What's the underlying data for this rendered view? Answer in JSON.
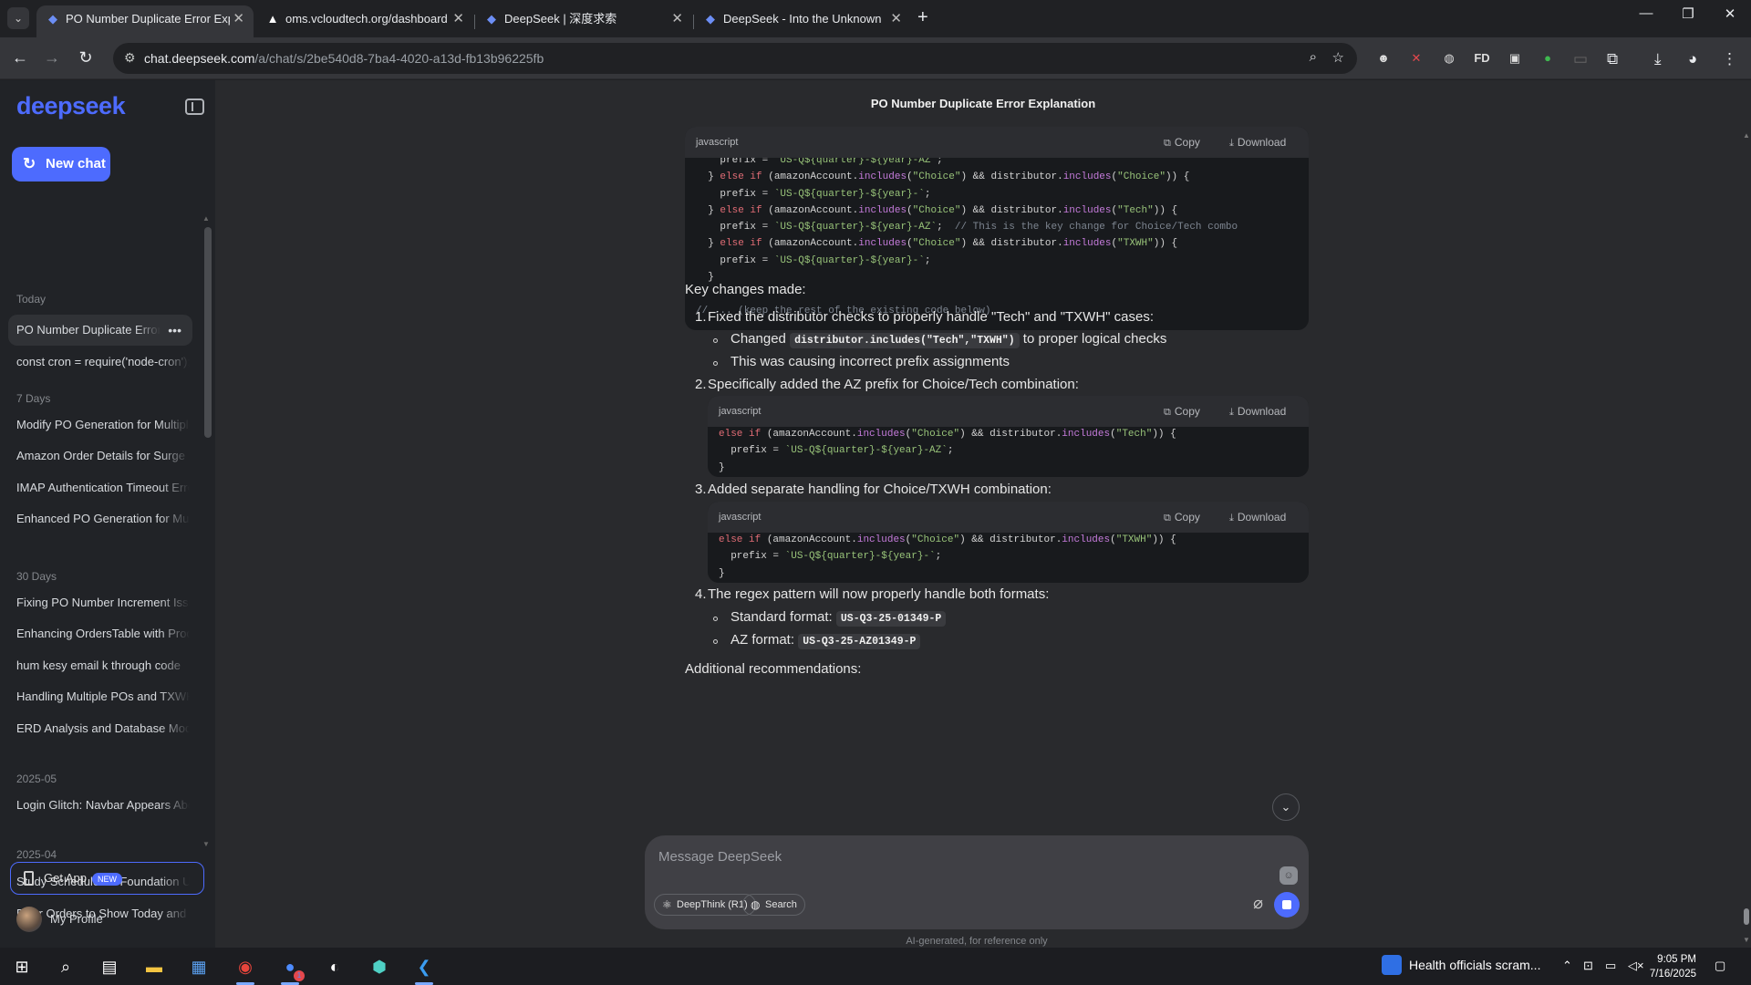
{
  "browser": {
    "tabs": [
      {
        "title": "PO Number Duplicate Error Exp",
        "favicon": "deepseek-whale-icon",
        "active": true
      },
      {
        "title": "oms.vcloudtech.org/dashboard",
        "favicon": "triangle-icon",
        "active": false
      },
      {
        "title": "DeepSeek | 深度求索",
        "favicon": "deepseek-whale-icon",
        "active": false
      },
      {
        "title": "DeepSeek - Into the Unknown",
        "favicon": "deepseek-whale-icon",
        "active": false
      }
    ],
    "url_host": "chat.deepseek.com",
    "url_path": "/a/chat/s/2be540d8-7ba4-4020-a13d-fb13b96225fb",
    "extensions": [
      "FD"
    ]
  },
  "sidebar": {
    "logo": "deepseek",
    "new_chat": "New chat",
    "groups": [
      {
        "label": "Today",
        "items": [
          "PO Number Duplicate Error Explanation",
          "const cron = require('node-cron');"
        ]
      },
      {
        "label": "7 Days",
        "items": [
          "Modify PO Generation for Multiple",
          "Amazon Order Details for Surge",
          "IMAP Authentication Timeout Error",
          "Enhanced PO Generation for Multiple"
        ]
      },
      {
        "label": "30 Days",
        "items": [
          "Fixing PO Number Increment Issue",
          "Enhancing OrdersTable with Prod",
          "hum kesy email k through code",
          "Handling Multiple POs and TXWH",
          "ERD Analysis and Database Model"
        ]
      },
      {
        "label": "2025-05",
        "items": [
          "Login Glitch: Navbar Appears Abo"
        ]
      },
      {
        "label": "2025-04",
        "items": [
          "Study Schedule for Foundation U",
          "Filter Orders to Show Today and"
        ]
      }
    ],
    "get_app": "Get App",
    "new_badge": "NEW",
    "profile": "My Profile"
  },
  "chat": {
    "title": "PO Number Duplicate Error Explanation",
    "code_lang": "javascript",
    "copy_label": "Copy",
    "download_label": "Download",
    "key_changes": "Key changes made:",
    "item1": "Fixed the distributor checks to properly handle \"Tech\" and \"TXWH\" cases:",
    "item1_b1_pre": "Changed",
    "item1_b1_code": "distributor.includes(\"Tech\",\"TXWH\")",
    "item1_b1_post": "to proper logical checks",
    "item1_b2": "This was causing incorrect prefix assignments",
    "item2": "Specifically added the AZ prefix for Choice/Tech combination:",
    "item3": "Added separate handling for Choice/TXWH combination:",
    "item4": "The regex pattern will now properly handle both formats:",
    "item4_b1_pre": "Standard format:",
    "item4_b1_code": "US-Q3-25-01349-P",
    "item4_b2_pre": "AZ format:",
    "item4_b2_code": "US-Q3-25-AZ01349-P",
    "additional": "Additional recommendations:",
    "nums": [
      "1.",
      "2.",
      "3.",
      "4."
    ]
  },
  "composer": {
    "placeholder": "Message DeepSeek",
    "deepthink": "DeepThink (R1)",
    "search": "Search",
    "disclaimer": "AI-generated, for reference only"
  },
  "taskbar": {
    "news": "Health officials scram...",
    "time": "9:05 PM",
    "date": "7/16/2025",
    "zoom_badge": "1"
  }
}
